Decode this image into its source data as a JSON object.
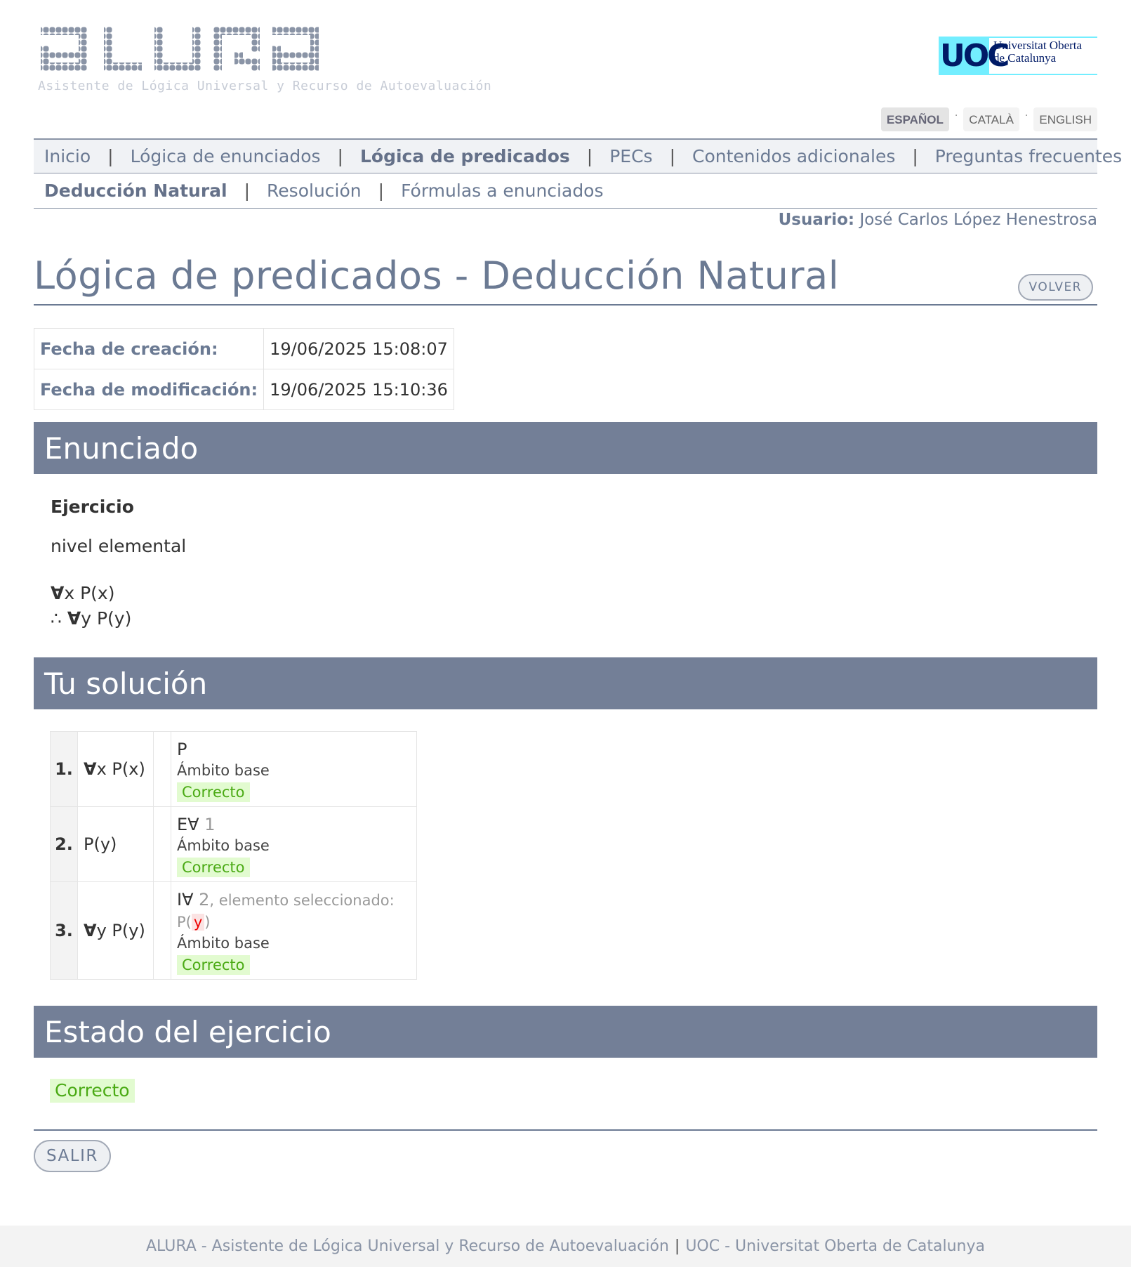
{
  "header": {
    "logo_text": "ALURA",
    "logo_subtitle": "Asistente de Lógica Universal y Recurso de Autoevaluación",
    "uoc_letters": "UOC",
    "uoc_name_line1": "Universitat Oberta",
    "uoc_name_line2": "de Catalunya"
  },
  "languages": [
    {
      "label": "Español",
      "active": true
    },
    {
      "label": "Català",
      "active": false
    },
    {
      "label": "English",
      "active": false
    }
  ],
  "nav_main": [
    "Inicio",
    "Lógica de enunciados",
    "Lógica de predicados",
    "PECs",
    "Contenidos adicionales",
    "Preguntas frecuentes"
  ],
  "nav_sub": [
    "Deducción Natural",
    "Resolución",
    "Fórmulas a enunciados"
  ],
  "user": {
    "label": "Usuario:",
    "name": "José Carlos López Henestrosa"
  },
  "page": {
    "title": "Lógica de predicados - Deducción Natural",
    "back_button": "VOLVER"
  },
  "dates": {
    "created_label": "Fecha de creación:",
    "created_value": "19/06/2025 15:08:07",
    "modified_label": "Fecha de modificación:",
    "modified_value": "19/06/2025 15:10:36"
  },
  "enunciado": {
    "heading": "Enunciado",
    "title": "Ejercicio",
    "level": "nivel elemental",
    "premise_quant": "∀",
    "premise_rest": "x P(x)",
    "conclusion_symbol": "∴",
    "conclusion_quant": "∀",
    "conclusion_rest": "y P(y)"
  },
  "solution": {
    "heading": "Tu solución",
    "steps": [
      {
        "num": "1.",
        "quant": "∀",
        "formula": "x P(x)",
        "rule": "P",
        "ref": "",
        "selection": "",
        "scope": "Ámbito base",
        "status": "Correcto"
      },
      {
        "num": "2.",
        "quant": "",
        "formula": "P(y)",
        "rule": "E∀",
        "ref": "1",
        "selection": "",
        "scope": "Ámbito base",
        "status": "Correcto"
      },
      {
        "num": "3.",
        "quant": "∀",
        "formula": "y P(y)",
        "rule": "I∀",
        "ref": "2",
        "selection_prefix": ", elemento seleccionado: P(",
        "selection_var": "y",
        "selection_suffix": ")",
        "scope": "Ámbito base",
        "status": "Correcto"
      }
    ]
  },
  "estado": {
    "heading": "Estado del ejercicio",
    "status": "Correcto"
  },
  "exit_button": "SALIR",
  "footer": {
    "left": "ALURA - Asistente de Lógica Universal y Recurso de Autoevaluación",
    "separator": "|",
    "right": "UOC - Universitat Oberta de Catalunya"
  },
  "colors": {
    "accent": "#737f97",
    "link": "#6b7a93",
    "success_bg": "#e2fbd0",
    "success_text": "#4aaa14",
    "uoc_cyan": "#73eeff",
    "uoc_navy": "#001a66"
  }
}
